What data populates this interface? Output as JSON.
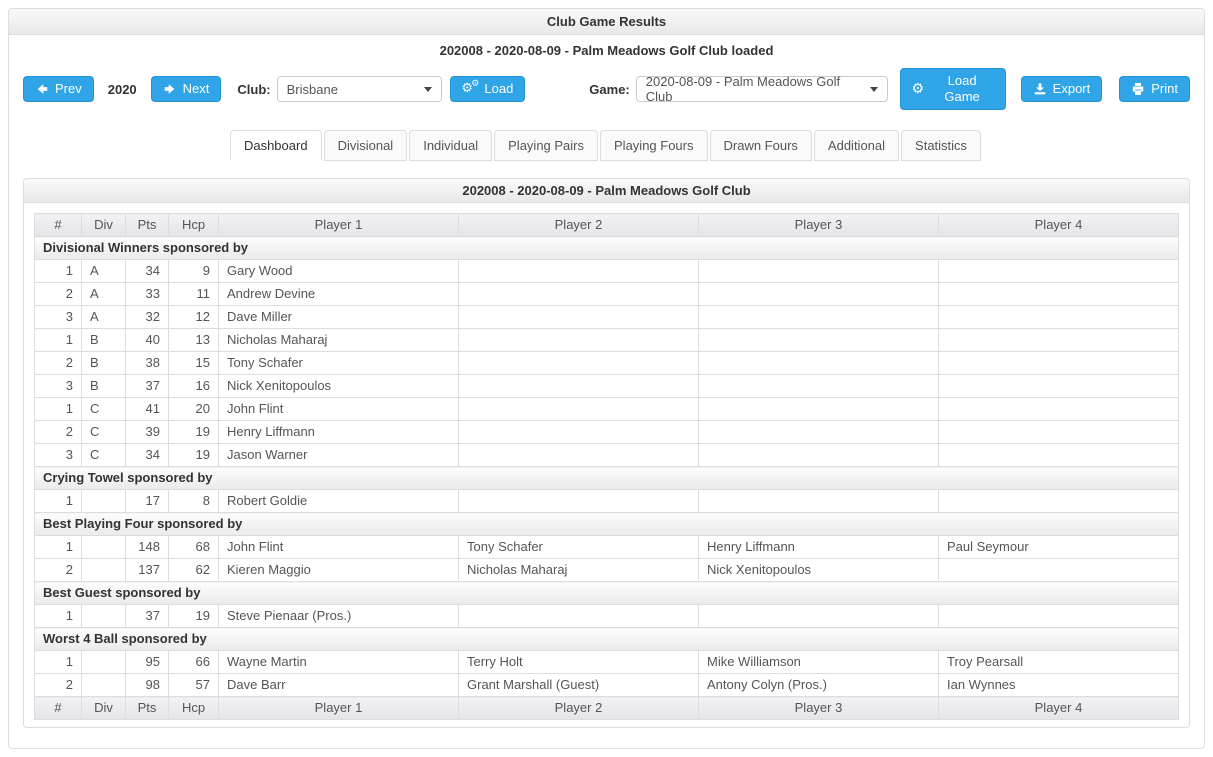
{
  "header": {
    "title": "Club Game Results",
    "loaded_text": "202008 - 2020-08-09 - Palm Meadows Golf Club loaded"
  },
  "toolbar": {
    "prev_label": "Prev",
    "year": "2020",
    "next_label": "Next",
    "club_label": "Club:",
    "club_value": "Brisbane",
    "load_label": "Load",
    "game_label": "Game:",
    "game_value": "2020-08-09 - Palm Meadows Golf Club",
    "load_game_label": "Load Game",
    "export_label": "Export",
    "print_label": "Print"
  },
  "icons": {
    "prev": "arrow-left",
    "next": "arrow-right",
    "load": "cogs",
    "load_game": "cog",
    "export": "download",
    "print": "printer",
    "select_caret": "caret-down",
    "gear_glyph": "⚙"
  },
  "colors": {
    "accent": "#2fa4e7",
    "accent_border": "#2494d4",
    "panel_border": "#dddddd",
    "heading_text": "#333333",
    "body_text": "#555555"
  },
  "tabs": {
    "active": "Dashboard",
    "items": [
      {
        "label": "Dashboard"
      },
      {
        "label": "Divisional"
      },
      {
        "label": "Individual"
      },
      {
        "label": "Playing Pairs"
      },
      {
        "label": "Playing Fours"
      },
      {
        "label": "Drawn Fours"
      },
      {
        "label": "Additional"
      },
      {
        "label": "Statistics"
      }
    ]
  },
  "table_panel": {
    "title": "202008 - 2020-08-09 - Palm Meadows Golf Club"
  },
  "table": {
    "columns": [
      "#",
      "Div",
      "Pts",
      "Hcp",
      "Player 1",
      "Player 2",
      "Player 3",
      "Player 4"
    ],
    "sections": [
      {
        "title": "Divisional Winners sponsored by",
        "rows": [
          [
            "1",
            "A",
            "34",
            "9",
            "Gary Wood",
            "",
            "",
            ""
          ],
          [
            "2",
            "A",
            "33",
            "11",
            "Andrew Devine",
            "",
            "",
            ""
          ],
          [
            "3",
            "A",
            "32",
            "12",
            "Dave Miller",
            "",
            "",
            ""
          ],
          [
            "1",
            "B",
            "40",
            "13",
            "Nicholas Maharaj",
            "",
            "",
            ""
          ],
          [
            "2",
            "B",
            "38",
            "15",
            "Tony Schafer",
            "",
            "",
            ""
          ],
          [
            "3",
            "B",
            "37",
            "16",
            "Nick Xenitopoulos",
            "",
            "",
            ""
          ],
          [
            "1",
            "C",
            "41",
            "20",
            "John Flint",
            "",
            "",
            ""
          ],
          [
            "2",
            "C",
            "39",
            "19",
            "Henry Liffmann",
            "",
            "",
            ""
          ],
          [
            "3",
            "C",
            "34",
            "19",
            "Jason Warner",
            "",
            "",
            ""
          ]
        ]
      },
      {
        "title": "Crying Towel sponsored by",
        "rows": [
          [
            "1",
            "",
            "17",
            "8",
            "Robert Goldie",
            "",
            "",
            ""
          ]
        ]
      },
      {
        "title": "Best Playing Four sponsored by",
        "rows": [
          [
            "1",
            "",
            "148",
            "68",
            "John Flint",
            "Tony Schafer",
            "Henry Liffmann",
            "Paul Seymour"
          ],
          [
            "2",
            "",
            "137",
            "62",
            "Kieren Maggio",
            "Nicholas Maharaj",
            "Nick Xenitopoulos",
            ""
          ]
        ]
      },
      {
        "title": "Best Guest sponsored by",
        "rows": [
          [
            "1",
            "",
            "37",
            "19",
            "Steve Pienaar (Pros.)",
            "",
            "",
            ""
          ]
        ]
      },
      {
        "title": "Worst 4 Ball sponsored by",
        "rows": [
          [
            "1",
            "",
            "95",
            "66",
            "Wayne Martin",
            "Terry Holt",
            "Mike Williamson",
            "Troy Pearsall"
          ],
          [
            "2",
            "",
            "98",
            "57",
            "Dave Barr",
            "Grant Marshall (Guest)",
            "Antony Colyn (Pros.)",
            "Ian Wynnes"
          ]
        ]
      }
    ]
  }
}
